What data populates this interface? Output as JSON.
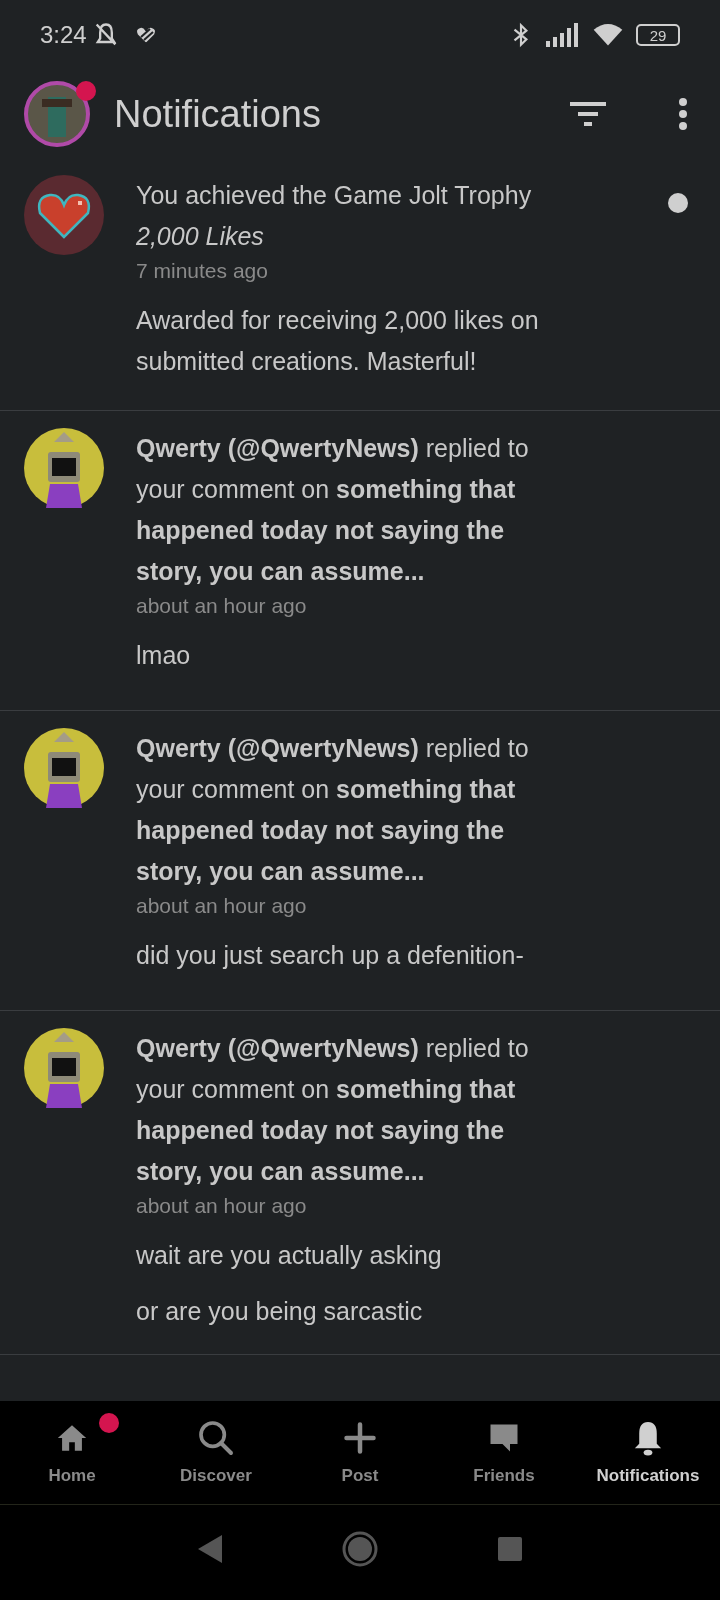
{
  "status_bar": {
    "time": "3:24",
    "battery": "29"
  },
  "header": {
    "title": "Notifications",
    "avatar_badge": true
  },
  "notifications": [
    {
      "kind": "trophy",
      "title": "You achieved the Game Jolt Trophy *2,000 Likes*",
      "time": "7 minutes ago",
      "body": [
        "Awarded for receiving 2,000 likes on submitted creations. Masterful!"
      ],
      "unread": true
    },
    {
      "kind": "reply",
      "title": "**Qwerty (@QwertyNews)** replied to your comment on **something that happened today not saying the story, you can assume...**",
      "time": "about an hour ago",
      "body": [
        "lmao"
      ],
      "unread": false
    },
    {
      "kind": "reply",
      "title": "**Qwerty (@QwertyNews)** replied to your comment on **something that happened today not saying the story, you can assume...**",
      "time": "about an hour ago",
      "body": [
        "did you just search up a defenition-"
      ],
      "unread": false
    },
    {
      "kind": "reply",
      "title": "**Qwerty (@QwertyNews)** replied to your comment on **something that happened today not saying the story, you can assume...**",
      "time": "about an hour ago",
      "body": [
        "wait are you actually asking",
        "or are you being sarcastic"
      ],
      "unread": false
    }
  ],
  "bottom_nav": [
    {
      "kind": "home",
      "label": "Home",
      "selected": false,
      "badge": true
    },
    {
      "kind": "discover",
      "label": "Discover",
      "selected": false,
      "badge": false
    },
    {
      "kind": "post",
      "label": "Post",
      "selected": false,
      "badge": false
    },
    {
      "kind": "friends",
      "label": "Friends",
      "selected": false,
      "badge": false
    },
    {
      "kind": "notifications",
      "label": "Notifications",
      "selected": true,
      "badge": false
    }
  ]
}
